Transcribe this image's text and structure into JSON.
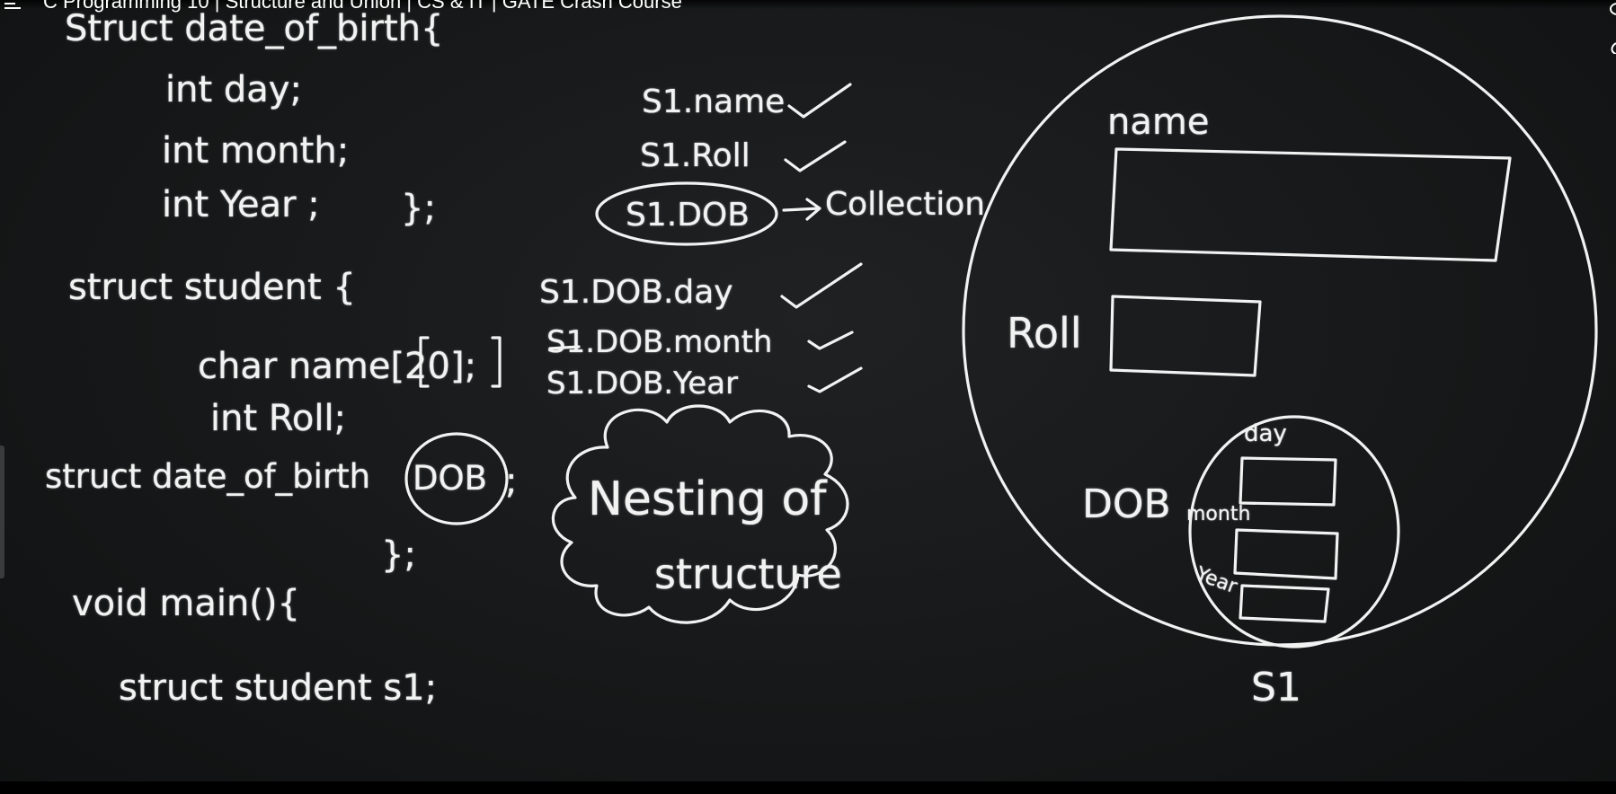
{
  "player": {
    "title": "C Programming 10 | Structure and Union | CS & IT | GATE Crash Course"
  },
  "code": {
    "line1": "Struct date_of_birth{",
    "line2": "int day;",
    "line3": "int month;",
    "line4": "int Year ;",
    "line4_close": "};",
    "line5": "struct student {",
    "line6": "char name[20];",
    "line7": "int Roll;",
    "line8_a": "struct date_of_birth",
    "line8_circled": "DOB",
    "line8_end": ";",
    "line9": "};",
    "line10": "void main(){",
    "line11": "struct student s1;"
  },
  "access": {
    "item1": "S1.name",
    "item2": "S1.Roll",
    "item3": "S1.DOB",
    "arrow_note": "Collection",
    "item4": "S1.DOB.day",
    "item5": "S1.DOB.month",
    "item6": "S1.DOB.Year"
  },
  "cloud": {
    "line1": "Nesting of",
    "line2": "structure"
  },
  "diagram": {
    "name_label": "name",
    "roll_label": "Roll",
    "dob_label": "DOB",
    "day_label": "day",
    "month_label": "month",
    "year_label": "Year",
    "variable_label": "S1"
  },
  "colors": {
    "chalk": "#f2f2f2",
    "board": "#1a1c1d"
  }
}
